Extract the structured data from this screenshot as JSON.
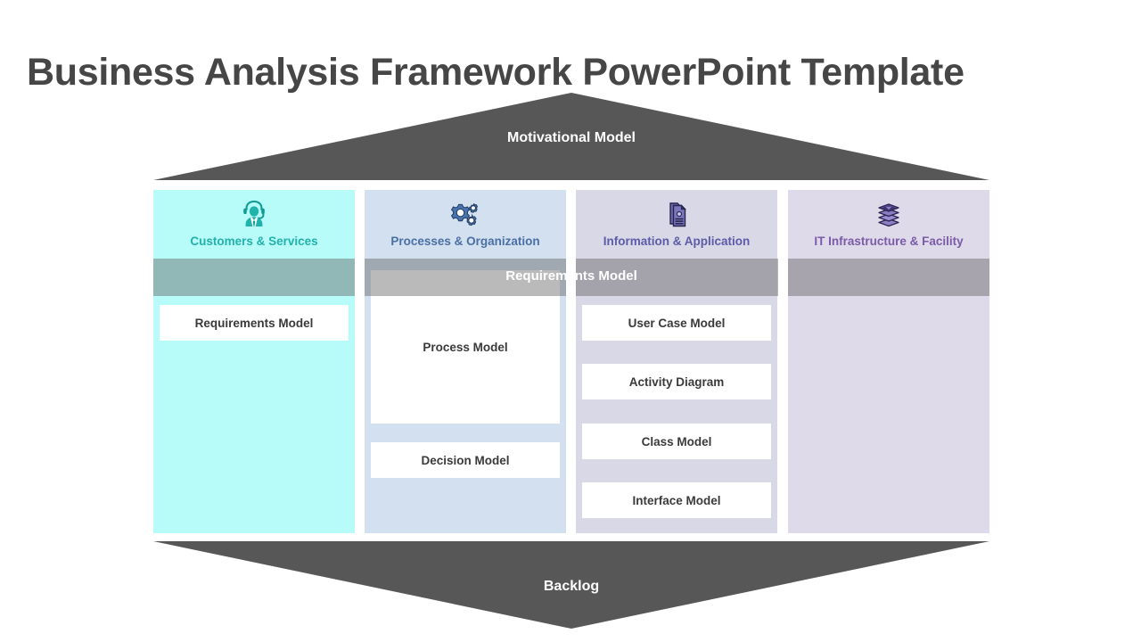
{
  "page": {
    "title": "Business Analysis Framework PowerPoint Template"
  },
  "colors": {
    "title_text": "#464646",
    "banner_fill": "#575757",
    "band_overlay": "rgba(90,90,90,0.42)",
    "col1_fill": "#B8FCFA",
    "col1_accent": "#23B1AA",
    "col2_fill": "#D3E0EF",
    "col2_accent": "#4A6FA5",
    "col3_fill": "#D9D8E6",
    "col3_accent": "#5B5BA8",
    "col4_fill": "#DEDAE9",
    "col4_accent": "#7B5BA8",
    "cell_fill": "#FFFFFF",
    "cell_text": "#3A3A3A"
  },
  "top_banner": {
    "label": "Motivational Model",
    "icon": "up-triangle-shape"
  },
  "bottom_banner": {
    "label": "Backlog",
    "icon": "down-triangle-shape"
  },
  "band": {
    "label": "Requirements Model"
  },
  "columns": [
    {
      "title": "Customers & Services",
      "icon": "headset-agent-icon",
      "cells": [
        {
          "label": "Requirements Model"
        }
      ]
    },
    {
      "title": "Processes & Organization",
      "icon": "gears-icon",
      "cells": [
        {
          "label": "Process Model"
        },
        {
          "label": "Decision Model"
        }
      ]
    },
    {
      "title": "Information & Application",
      "icon": "document-lock-icon",
      "cells": [
        {
          "label": "User Case Model"
        },
        {
          "label": "Activity Diagram"
        },
        {
          "label": "Class  Model"
        },
        {
          "label": "Interface Model"
        }
      ]
    },
    {
      "title": "IT Infrastructure & Facility",
      "icon": "stacked-layers-icon",
      "cells": []
    }
  ]
}
